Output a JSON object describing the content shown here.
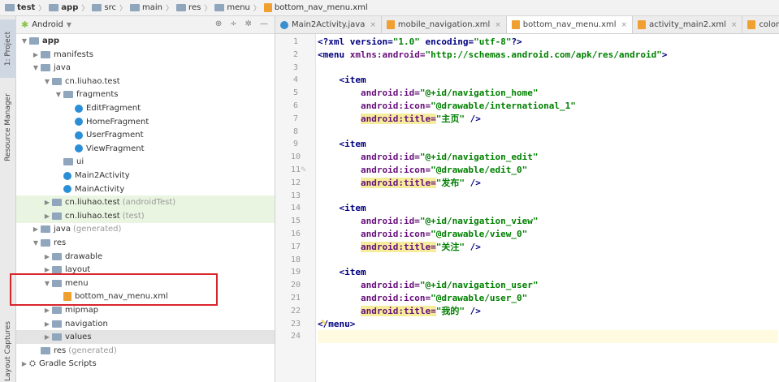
{
  "breadcrumb": [
    {
      "label": "test",
      "icon": "folder-icon"
    },
    {
      "label": "app",
      "icon": "folder-icon"
    },
    {
      "label": "src",
      "icon": "folder-icon"
    },
    {
      "label": "main",
      "icon": "folder-icon"
    },
    {
      "label": "res",
      "icon": "folder-icon"
    },
    {
      "label": "menu",
      "icon": "folder-icon"
    },
    {
      "label": "bottom_nav_menu.xml",
      "icon": "xml-file-icon"
    }
  ],
  "left_stripe": {
    "tab1": "1: Project",
    "tab2": "Resource Manager",
    "tab3": "Layout Captures"
  },
  "project_panel": {
    "view_label": "Android",
    "view_icon": "android-icon"
  },
  "tree": [
    {
      "label": "app",
      "sub": "",
      "depth": 0,
      "arrow": "▼",
      "icon": "folder",
      "bold": true,
      "bg": ""
    },
    {
      "label": "manifests",
      "sub": "",
      "depth": 1,
      "arrow": "▶",
      "icon": "folder",
      "bg": ""
    },
    {
      "label": "java",
      "sub": "",
      "depth": 1,
      "arrow": "▼",
      "icon": "folder",
      "bg": ""
    },
    {
      "label": "cn.liuhao.test",
      "sub": "",
      "depth": 2,
      "arrow": "▼",
      "icon": "folder",
      "bg": ""
    },
    {
      "label": "fragments",
      "sub": "",
      "depth": 3,
      "arrow": "▼",
      "icon": "folder",
      "bg": ""
    },
    {
      "label": "EditFragment",
      "sub": "",
      "depth": 4,
      "arrow": "",
      "icon": "class",
      "bg": ""
    },
    {
      "label": "HomeFragment",
      "sub": "",
      "depth": 4,
      "arrow": "",
      "icon": "class",
      "bg": ""
    },
    {
      "label": "UserFragment",
      "sub": "",
      "depth": 4,
      "arrow": "",
      "icon": "class",
      "bg": ""
    },
    {
      "label": "ViewFragment",
      "sub": "",
      "depth": 4,
      "arrow": "",
      "icon": "class",
      "bg": ""
    },
    {
      "label": "ui",
      "sub": "",
      "depth": 3,
      "arrow": "",
      "icon": "folder",
      "bg": ""
    },
    {
      "label": "Main2Activity",
      "sub": "",
      "depth": 3,
      "arrow": "",
      "icon": "class",
      "bg": ""
    },
    {
      "label": "MainActivity",
      "sub": "",
      "depth": 3,
      "arrow": "",
      "icon": "class",
      "bg": ""
    },
    {
      "label": "cn.liuhao.test",
      "sub": "(androidTest)",
      "depth": 2,
      "arrow": "▶",
      "icon": "folder",
      "bg": "green"
    },
    {
      "label": "cn.liuhao.test",
      "sub": "(test)",
      "depth": 2,
      "arrow": "▶",
      "icon": "folder",
      "bg": "green"
    },
    {
      "label": "java",
      "sub": "(generated)",
      "depth": 1,
      "arrow": "▶",
      "icon": "folder",
      "bg": ""
    },
    {
      "label": "res",
      "sub": "",
      "depth": 1,
      "arrow": "▼",
      "icon": "folder",
      "bg": ""
    },
    {
      "label": "drawable",
      "sub": "",
      "depth": 2,
      "arrow": "▶",
      "icon": "folder",
      "bg": ""
    },
    {
      "label": "layout",
      "sub": "",
      "depth": 2,
      "arrow": "▶",
      "icon": "folder",
      "bg": ""
    },
    {
      "label": "menu",
      "sub": "",
      "depth": 2,
      "arrow": "▼",
      "icon": "folder",
      "bg": ""
    },
    {
      "label": "bottom_nav_menu.xml",
      "sub": "",
      "depth": 3,
      "arrow": "",
      "icon": "xml",
      "bg": ""
    },
    {
      "label": "mipmap",
      "sub": "",
      "depth": 2,
      "arrow": "▶",
      "icon": "folder",
      "bg": ""
    },
    {
      "label": "navigation",
      "sub": "",
      "depth": 2,
      "arrow": "▶",
      "icon": "folder",
      "bg": ""
    },
    {
      "label": "values",
      "sub": "",
      "depth": 2,
      "arrow": "▶",
      "icon": "folder",
      "bg": "grey"
    },
    {
      "label": "res",
      "sub": "(generated)",
      "depth": 1,
      "arrow": "",
      "icon": "folder",
      "bg": ""
    },
    {
      "label": "Gradle Scripts",
      "sub": "",
      "depth": 0,
      "arrow": "▶",
      "icon": "gradle",
      "bg": ""
    }
  ],
  "tabs": [
    {
      "label": "Main2Activity.java",
      "icon": "java-class-icon",
      "active": false
    },
    {
      "label": "mobile_navigation.xml",
      "icon": "xml-file-icon",
      "active": false
    },
    {
      "label": "bottom_nav_menu.xml",
      "icon": "xml-file-icon",
      "active": true
    },
    {
      "label": "activity_main2.xml",
      "icon": "xml-file-icon",
      "active": false
    },
    {
      "label": "colors.xml",
      "icon": "xml-file-icon",
      "active": false
    }
  ],
  "line_numbers": [
    "1",
    "2",
    "3",
    "4",
    "5",
    "6",
    "7",
    "8",
    "9",
    "10",
    "11",
    "12",
    "13",
    "14",
    "15",
    "16",
    "17",
    "18",
    "19",
    "20",
    "21",
    "22",
    "23",
    "24"
  ],
  "code_lines": [
    [
      {
        "t": "<?xml version=",
        "c": "tag"
      },
      {
        "t": "\"1.0\"",
        "c": "val"
      },
      {
        "t": " encoding=",
        "c": "tag"
      },
      {
        "t": "\"utf-8\"",
        "c": "val"
      },
      {
        "t": "?>",
        "c": "tag"
      }
    ],
    [
      {
        "t": "<menu ",
        "c": "tag"
      },
      {
        "t": "xmlns:android=",
        "c": "attr"
      },
      {
        "t": "\"http://schemas.android.com/apk/res/android\"",
        "c": "val"
      },
      {
        "t": ">",
        "c": "tag"
      }
    ],
    [],
    [
      {
        "t": "    <item",
        "c": "tag"
      }
    ],
    [
      {
        "t": "        android:id=",
        "c": "attr"
      },
      {
        "t": "\"@+id/navigation_home\"",
        "c": "val"
      }
    ],
    [
      {
        "t": "        android:icon=",
        "c": "attr"
      },
      {
        "t": "\"@drawable/international_1\"",
        "c": "val"
      }
    ],
    [
      {
        "t": "        ",
        "c": ""
      },
      {
        "t": "android:title=",
        "c": "attr hl"
      },
      {
        "t": "\"主页\"",
        "c": "val"
      },
      {
        "t": " />",
        "c": "tag"
      }
    ],
    [],
    [
      {
        "t": "    <item",
        "c": "tag"
      }
    ],
    [
      {
        "t": "        android:id=",
        "c": "attr"
      },
      {
        "t": "\"@+id/navigation_edit\"",
        "c": "val"
      }
    ],
    [
      {
        "t": "        android:icon=",
        "c": "attr"
      },
      {
        "t": "\"@drawable/edit_0\"",
        "c": "val"
      }
    ],
    [
      {
        "t": "        ",
        "c": ""
      },
      {
        "t": "android:title=",
        "c": "attr hl"
      },
      {
        "t": "\"发布\"",
        "c": "val"
      },
      {
        "t": " />",
        "c": "tag"
      }
    ],
    [],
    [
      {
        "t": "    <item",
        "c": "tag"
      }
    ],
    [
      {
        "t": "        android:id=",
        "c": "attr"
      },
      {
        "t": "\"@+id/navigation_view\"",
        "c": "val"
      }
    ],
    [
      {
        "t": "        android:icon=",
        "c": "attr"
      },
      {
        "t": "\"@drawable/view_0\"",
        "c": "val"
      }
    ],
    [
      {
        "t": "        ",
        "c": ""
      },
      {
        "t": "android:title=",
        "c": "attr hl"
      },
      {
        "t": "\"关注\"",
        "c": "val"
      },
      {
        "t": " />",
        "c": "tag"
      }
    ],
    [],
    [
      {
        "t": "    <item",
        "c": "tag"
      }
    ],
    [
      {
        "t": "        android:id=",
        "c": "attr"
      },
      {
        "t": "\"@+id/navigation_user\"",
        "c": "val"
      }
    ],
    [
      {
        "t": "        android:icon=",
        "c": "attr"
      },
      {
        "t": "\"@drawable/user_0\"",
        "c": "val"
      }
    ],
    [
      {
        "t": "        ",
        "c": ""
      },
      {
        "t": "android:title=",
        "c": "attr hl"
      },
      {
        "t": "\"我的\"",
        "c": "val"
      },
      {
        "t": " />",
        "c": "tag"
      }
    ],
    [
      {
        "t": "</menu>",
        "c": "tag"
      }
    ],
    []
  ],
  "colors": {
    "tag": "#000080",
    "attr": "#660e7a",
    "value": "#008000",
    "highlight": "#f5ed9c",
    "red_box": "#d8242a"
  }
}
